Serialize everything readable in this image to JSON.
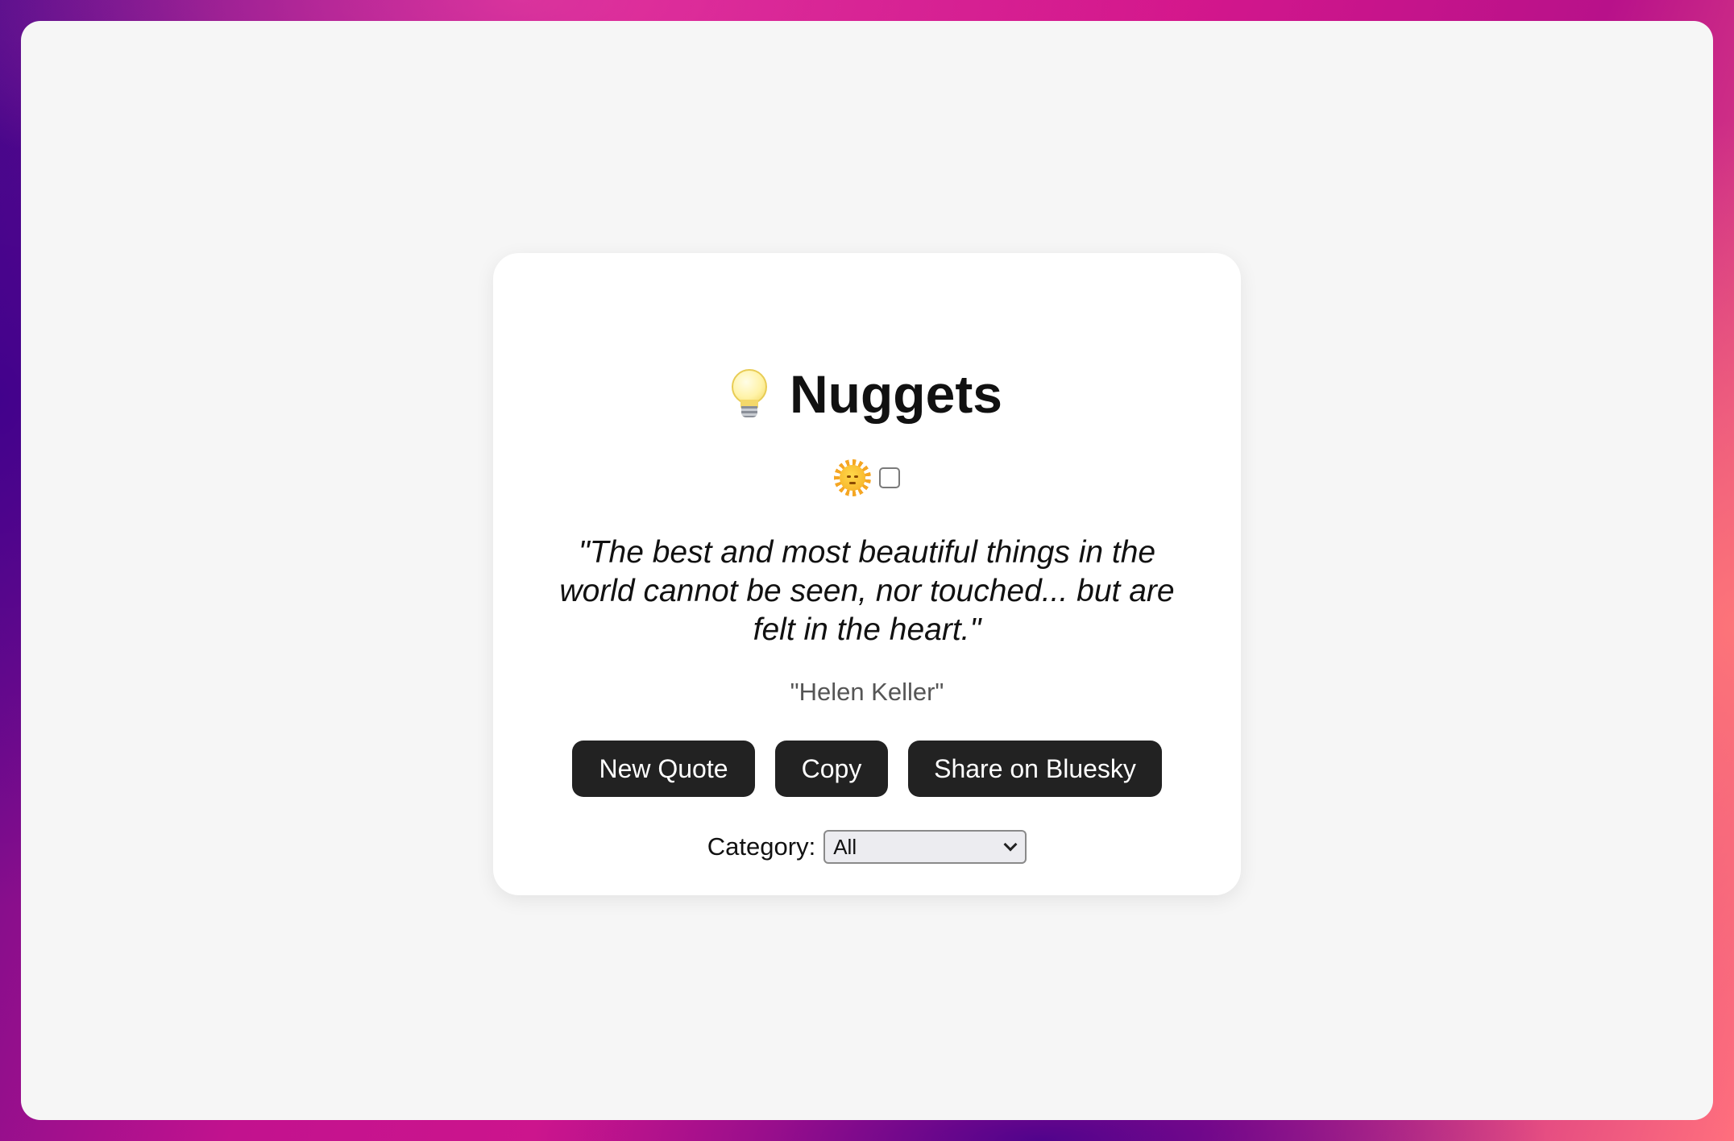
{
  "app": {
    "title": "Nuggets",
    "title_icon": "lightbulb-icon"
  },
  "theme": {
    "icon": "sun-icon",
    "dark_mode_checked": false
  },
  "quote": {
    "text": "\"The best and most beautiful things in the world cannot be seen, nor touched... but are felt in the heart.\"",
    "author": "\"Helen Keller\""
  },
  "actions": {
    "new_quote_label": "New Quote",
    "copy_label": "Copy",
    "share_label": "Share on Bluesky"
  },
  "category": {
    "label": "Category:",
    "selected": "All"
  },
  "colors": {
    "button_bg": "#222222",
    "card_bg": "#ffffff",
    "page_bg": "#f6f6f6",
    "author_text": "#555555"
  }
}
